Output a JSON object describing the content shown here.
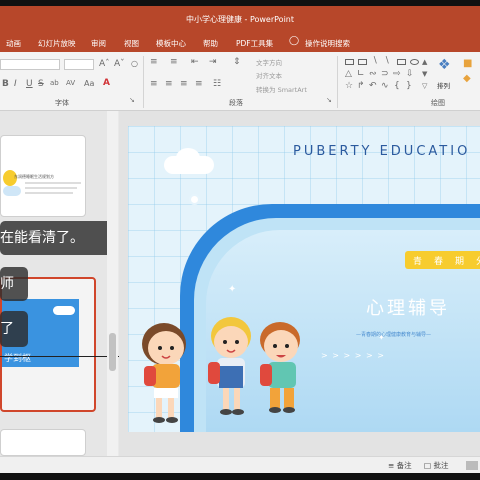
{
  "window": {
    "title": "中小学心理健康 - PowerPoint"
  },
  "menu": [
    "动画",
    "幻灯片放映",
    "审阅",
    "视图",
    "模板中心",
    "帮助",
    "PDF工具集",
    "操作说明搜索"
  ],
  "ribbon": {
    "groups": [
      "字体",
      "段落",
      "绘图"
    ],
    "font_buttons": [
      "B",
      "I",
      "U",
      "S",
      "ab",
      "AV",
      "Aa",
      "A"
    ],
    "paragraph_items": [
      "文字方向",
      "对齐文本",
      "转换为 SmartArt"
    ],
    "arrange_label": "排列"
  },
  "thumbnails": {
    "slide1_heading": "东润德睡眠生活规划方",
    "captions": [
      "在能看清了。",
      "师",
      "了"
    ],
    "slide2_text": "学到枢"
  },
  "slide": {
    "heading": "PUBERTY EDUCATIO",
    "pill_chars": [
      "青",
      "春",
      "期",
      "分"
    ],
    "title": "心理辅导",
    "subtext": "—青春期的心理健康教育与辅导—",
    "arrows": "> > > > > >"
  },
  "statusbar": {
    "notes": "备注",
    "comments": "批注"
  },
  "colors": {
    "accent": "#b7472a",
    "slide_blue": "#2f88dc",
    "pill_yellow": "#f7cc2e"
  }
}
